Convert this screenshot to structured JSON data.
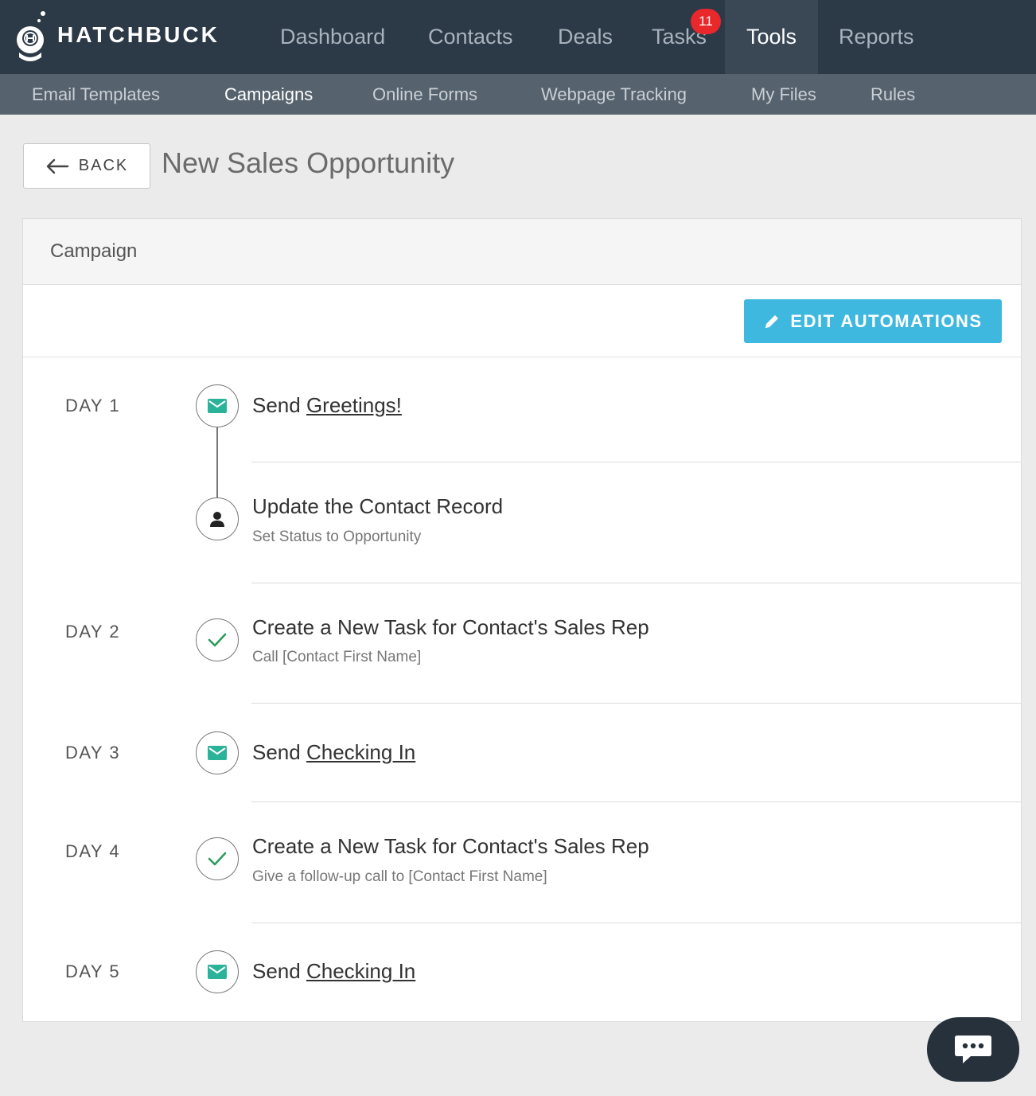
{
  "brand": {
    "name": "HATCHBUCK"
  },
  "topnav": {
    "items": [
      {
        "label": "Dashboard"
      },
      {
        "label": "Contacts"
      },
      {
        "label": "Deals"
      },
      {
        "label": "Tasks",
        "badge": "11"
      },
      {
        "label": "Tools",
        "active": true
      },
      {
        "label": "Reports"
      }
    ]
  },
  "subnav": {
    "items": [
      {
        "label": "Email Templates"
      },
      {
        "label": "Campaigns",
        "active": true
      },
      {
        "label": "Online Forms"
      },
      {
        "label": "Webpage Tracking"
      },
      {
        "label": "My Files"
      },
      {
        "label": "Rules"
      }
    ]
  },
  "header": {
    "back_label": "BACK",
    "title": "New Sales Opportunity"
  },
  "panel": {
    "heading": "Campaign",
    "edit_button": "EDIT AUTOMATIONS",
    "steps": [
      {
        "day": "DAY 1",
        "icon": "email-icon",
        "prefix": "Send ",
        "link": "Greetings!"
      },
      {
        "day": "",
        "icon": "person-icon",
        "title": "Update the Contact Record",
        "subtitle": "Set Status to Opportunity"
      },
      {
        "day": "DAY 2",
        "icon": "check-icon",
        "title": "Create a New Task for Contact's Sales Rep",
        "subtitle": "Call [Contact First Name]"
      },
      {
        "day": "DAY 3",
        "icon": "email-icon",
        "prefix": "Send ",
        "link": "Checking In"
      },
      {
        "day": "DAY 4",
        "icon": "check-icon",
        "title": "Create a New Task for Contact's Sales Rep",
        "subtitle": "Give a follow-up call to [Contact First Name]"
      },
      {
        "day": "DAY 5",
        "icon": "email-icon",
        "prefix": "Send ",
        "link": "Checking In"
      }
    ]
  },
  "colors": {
    "nav_bg": "#2c3a47",
    "subnav_bg": "#56626d",
    "accent": "#3fb8e0",
    "email_icon": "#2bb39a",
    "badge": "#e8282b"
  },
  "chat": {
    "icon": "chat-icon"
  }
}
